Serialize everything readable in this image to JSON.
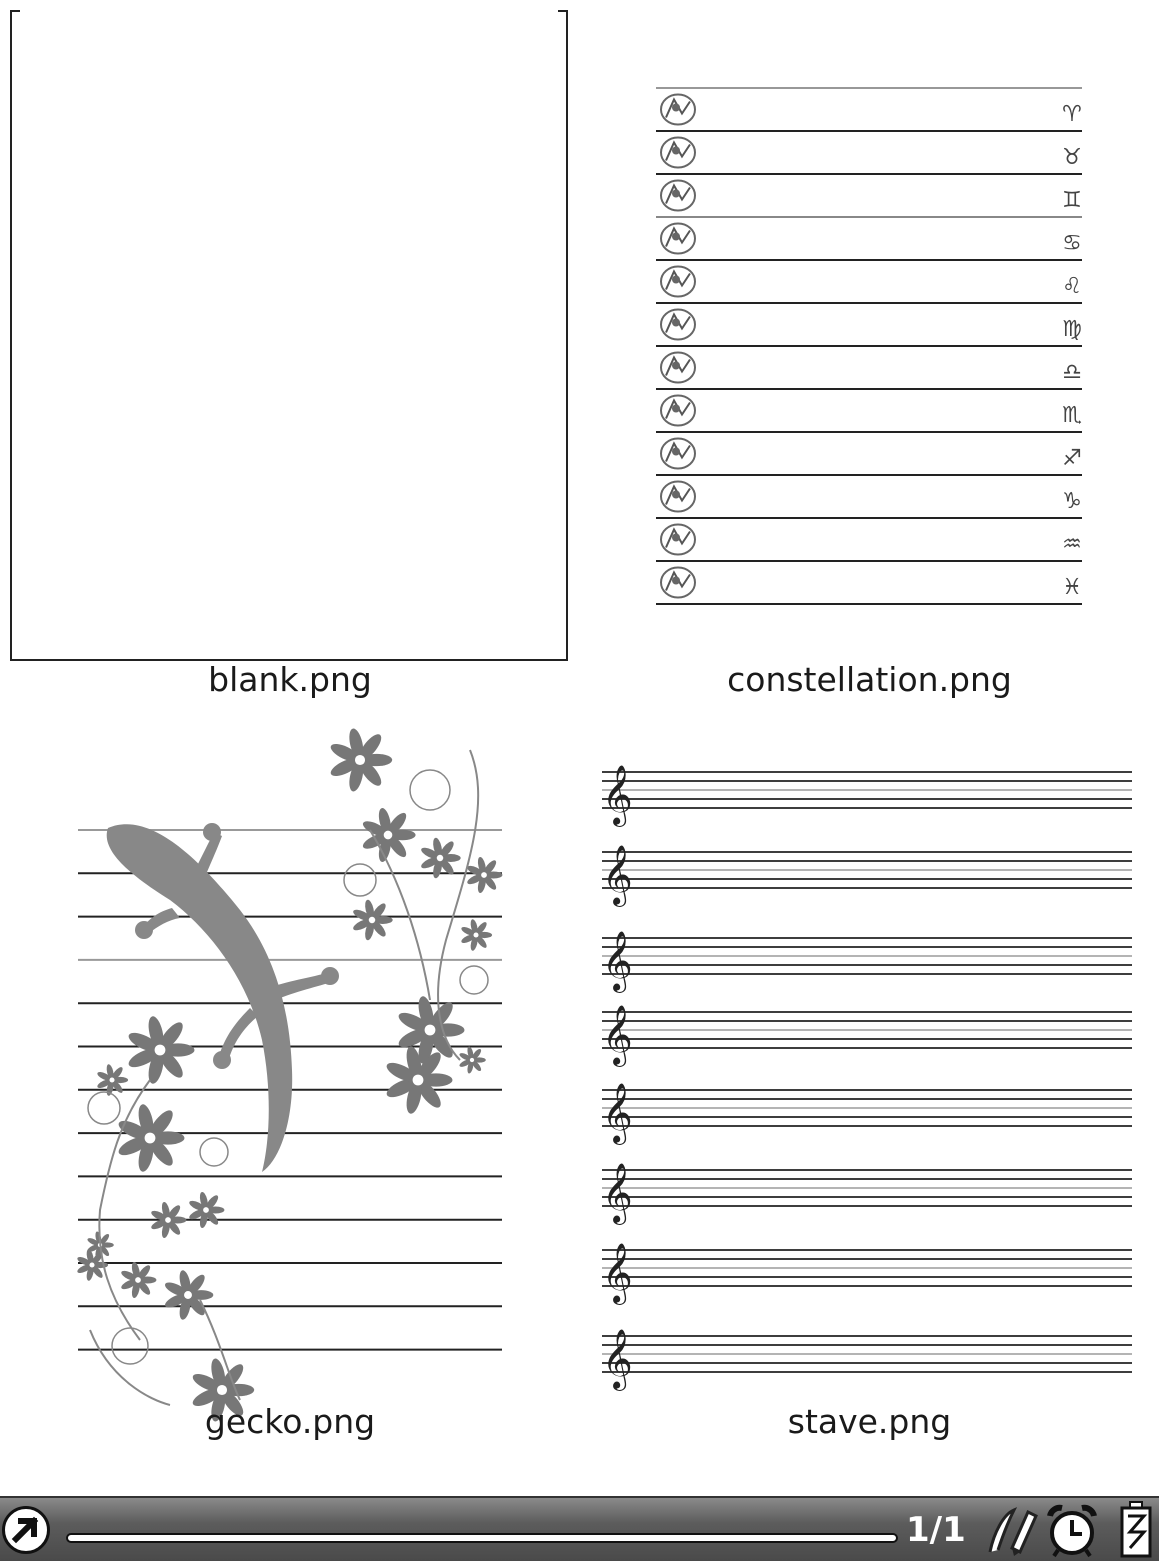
{
  "tiles": [
    {
      "caption": "blank.png"
    },
    {
      "caption": "constellation.png"
    },
    {
      "caption": "gecko.png"
    },
    {
      "caption": "stave.png"
    }
  ],
  "zodiac_glyphs": [
    "♈",
    "♉",
    "♊",
    "♋",
    "♌",
    "♍",
    "♎",
    "♏",
    "♐",
    "♑",
    "♒",
    "♓"
  ],
  "statusbar": {
    "page_counter": "1/1",
    "icons": [
      "home-icon",
      "pen-icon",
      "alarm-clock-icon",
      "battery-icon"
    ]
  }
}
